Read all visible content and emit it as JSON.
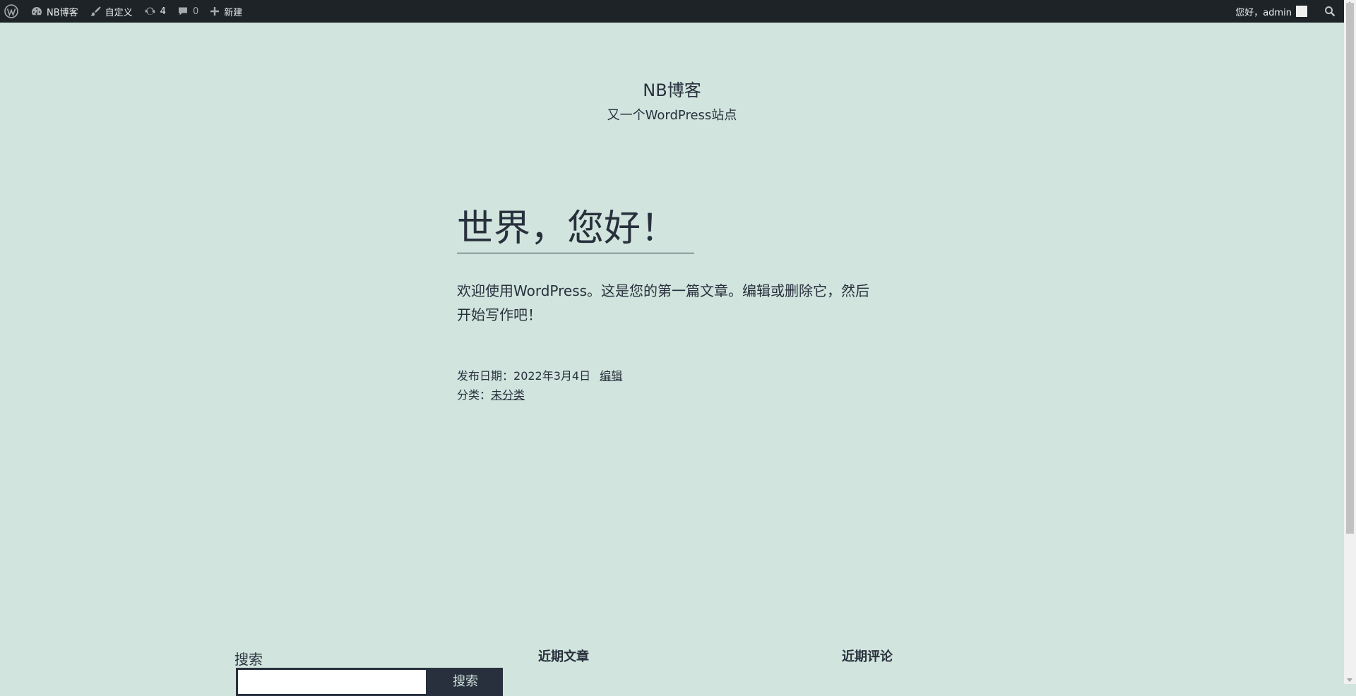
{
  "admin_bar": {
    "site_name": "NB博客",
    "customize": "自定义",
    "updates_count": "4",
    "comments_count": "0",
    "new_label": "新建",
    "greeting": "您好，admin"
  },
  "header": {
    "site_title": "NB博客",
    "tagline": "又一个WordPress站点"
  },
  "post": {
    "title": "世界，您好！",
    "content": "欢迎使用WordPress。这是您的第一篇文章。编辑或删除它，然后开始写作吧！",
    "posted_on_label": "发布日期：",
    "date": "2022年3月4日",
    "edit_label": "编辑",
    "category_label": "分类：",
    "category": "未分类"
  },
  "footer": {
    "search_title": "搜索",
    "search_button": "搜索",
    "recent_posts_title": "近期文章",
    "recent_comments_title": "近期评论"
  }
}
